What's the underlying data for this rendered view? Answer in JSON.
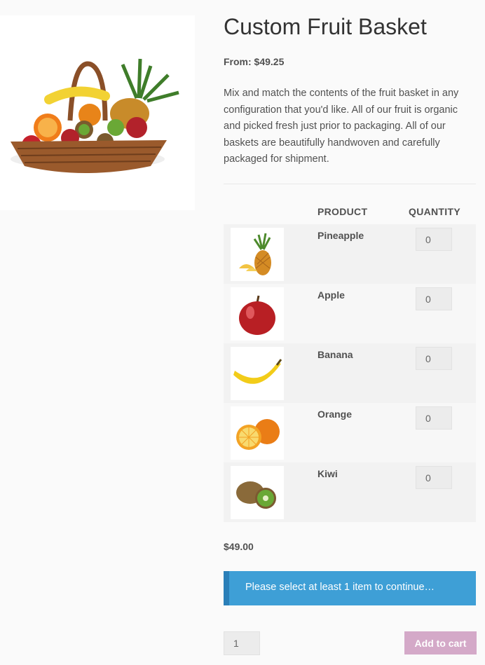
{
  "product": {
    "title": "Custom Fruit Basket",
    "price_from": "From: $49.25",
    "description": "Mix and match the contents of the fruit basket in any configuration that you'd like. All of our fruit is organic and picked fresh just prior to packaging. All of our baskets are beautifully handwoven and carefully packaged for shipment."
  },
  "table": {
    "col_product": "PRODUCT",
    "col_quantity": "QUANTITY",
    "items": [
      {
        "name": "Pineapple",
        "qty": "0",
        "icon": "pineapple-icon"
      },
      {
        "name": "Apple",
        "qty": "0",
        "icon": "apple-icon"
      },
      {
        "name": "Banana",
        "qty": "0",
        "icon": "banana-icon"
      },
      {
        "name": "Orange",
        "qty": "0",
        "icon": "orange-icon"
      },
      {
        "name": "Kiwi",
        "qty": "0",
        "icon": "kiwi-icon"
      }
    ]
  },
  "total": "$49.00",
  "notice": "Please select at least 1 item to continue…",
  "cart": {
    "quantity": "1",
    "add_label": "Add to cart"
  },
  "colors": {
    "notice_bg": "#3e9fd6",
    "button_bg": "#d4a9c8"
  }
}
